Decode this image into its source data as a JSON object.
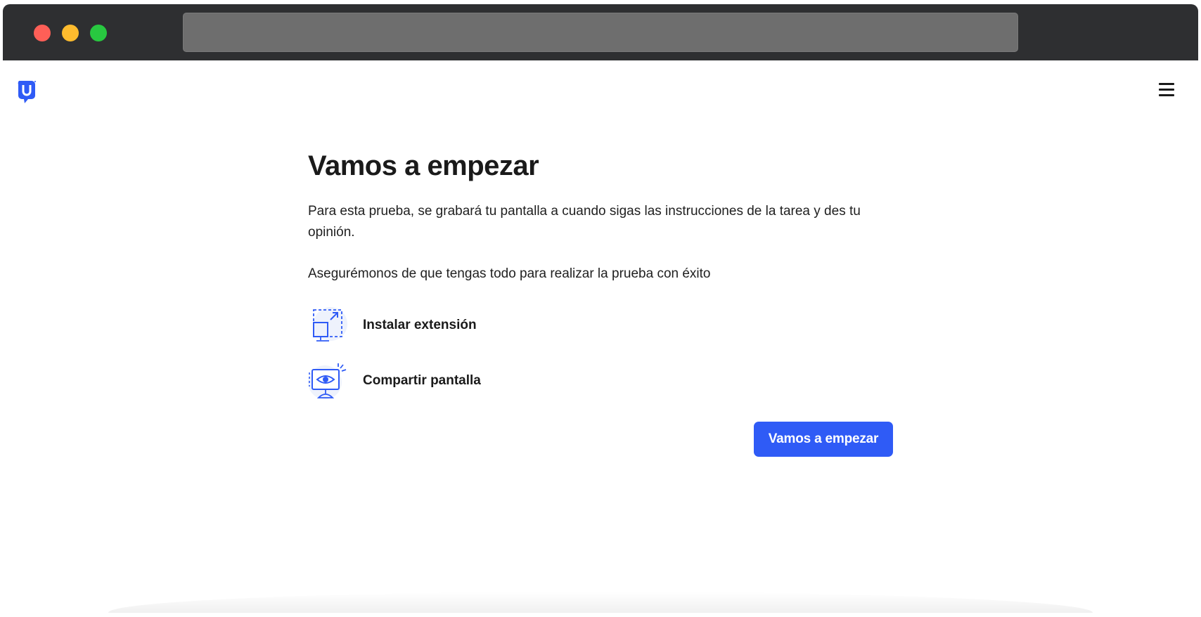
{
  "browser": {
    "address_value": ""
  },
  "header": {
    "logo_icon": "usertesting-logo-icon",
    "menu_icon": "hamburger-menu-icon"
  },
  "main": {
    "title": "Vamos a empezar",
    "intro": "Para esta prueba, se grabará tu pantalla a cuando sigas las instrucciones de la tarea y des tu opinión.",
    "subintro": "Asegurémonos de que tengas todo para realizar la prueba con éxito",
    "steps": [
      {
        "label": "Instalar extensión",
        "icon": "install-extension-icon"
      },
      {
        "label": "Compartir pantalla",
        "icon": "share-screen-icon"
      }
    ],
    "cta_label": "Vamos a empezar"
  },
  "colors": {
    "accent": "#2f5bf6",
    "titlebar": "#2e2f31",
    "text": "#1a1a1a"
  }
}
